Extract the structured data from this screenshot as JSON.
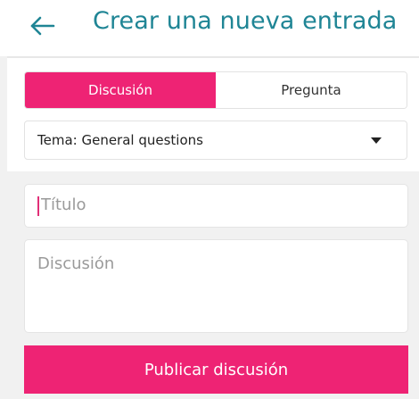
{
  "header": {
    "title": "Crear una nueva entrada",
    "back_icon": "arrow-left-icon"
  },
  "tabs": [
    {
      "label": "Discusión",
      "active": true
    },
    {
      "label": "Pregunta",
      "active": false
    }
  ],
  "topic_select": {
    "value": "Tema: General questions",
    "icon": "caret-down-icon"
  },
  "form": {
    "title_placeholder": "Título",
    "body_placeholder": "Discusión"
  },
  "actions": {
    "publish_label": "Publicar discusión"
  },
  "colors": {
    "accent_pink": "#ee2374",
    "title_teal": "#1f8595",
    "background": "#f1f1f1"
  }
}
